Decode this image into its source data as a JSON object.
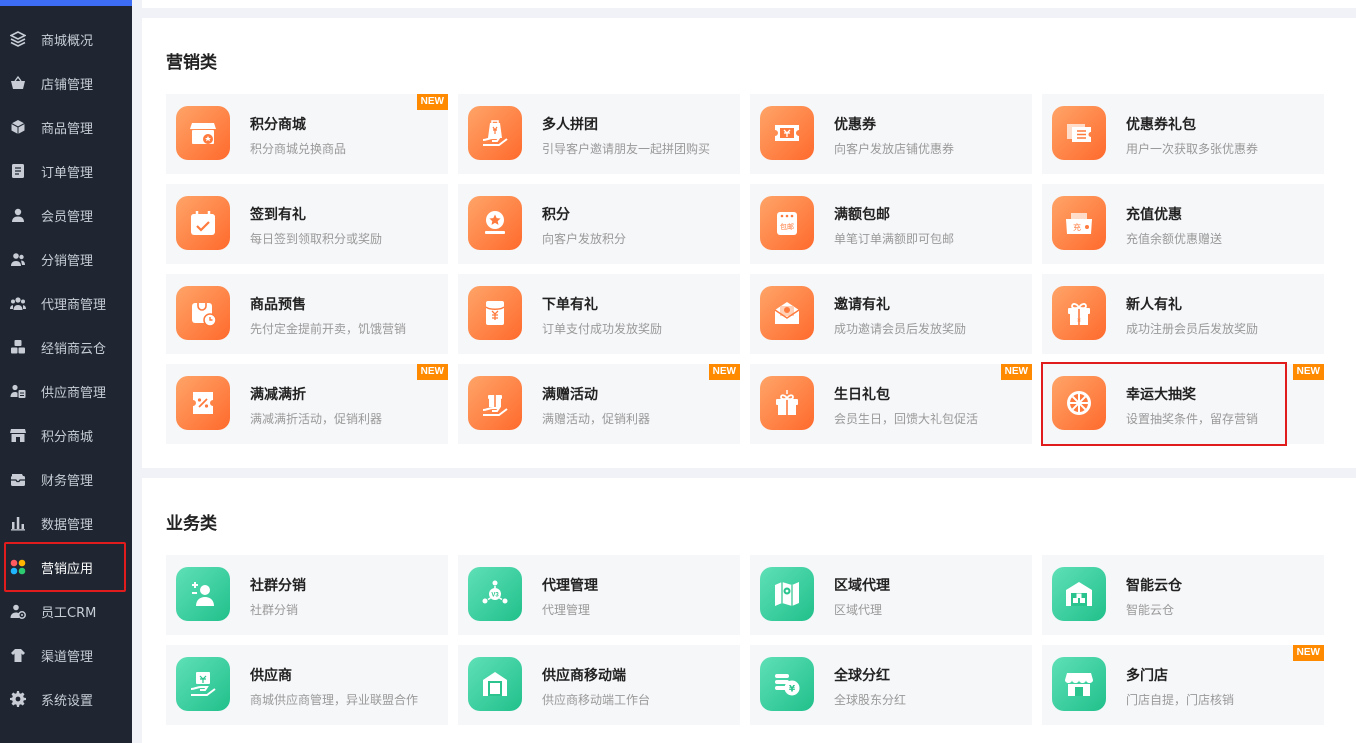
{
  "sidebar": {
    "items": [
      {
        "label": "商城概况",
        "icon": "layers-icon"
      },
      {
        "label": "店铺管理",
        "icon": "basket-icon"
      },
      {
        "label": "商品管理",
        "icon": "cube-icon"
      },
      {
        "label": "订单管理",
        "icon": "document-icon"
      },
      {
        "label": "会员管理",
        "icon": "user-icon"
      },
      {
        "label": "分销管理",
        "icon": "users-icon"
      },
      {
        "label": "代理商管理",
        "icon": "group-icon"
      },
      {
        "label": "经销商云仓",
        "icon": "boxes-icon"
      },
      {
        "label": "供应商管理",
        "icon": "supplier-icon"
      },
      {
        "label": "积分商城",
        "icon": "store-icon"
      },
      {
        "label": "财务管理",
        "icon": "wallet-icon"
      },
      {
        "label": "数据管理",
        "icon": "bar-chart-icon"
      },
      {
        "label": "营销应用",
        "icon": "apps-icon",
        "active": true
      },
      {
        "label": "员工CRM",
        "icon": "staff-icon"
      },
      {
        "label": "渠道管理",
        "icon": "channel-icon"
      },
      {
        "label": "系统设置",
        "icon": "gear-icon"
      }
    ]
  },
  "marketing": {
    "title": "营销类",
    "cards": [
      {
        "title": "积分商城",
        "desc": "积分商城兑换商品",
        "badge": "NEW",
        "icon": "points-store-icon"
      },
      {
        "title": "多人拼团",
        "desc": "引导客户邀请朋友一起拼团购买",
        "icon": "group-buy-icon"
      },
      {
        "title": "优惠券",
        "desc": "向客户发放店铺优惠券",
        "icon": "coupon-icon"
      },
      {
        "title": "优惠券礼包",
        "desc": "用户一次获取多张优惠券",
        "icon": "coupon-pack-icon"
      },
      {
        "title": "签到有礼",
        "desc": "每日签到领取积分或奖励",
        "icon": "calendar-check-icon"
      },
      {
        "title": "积分",
        "desc": "向客户发放积分",
        "icon": "star-icon"
      },
      {
        "title": "满额包邮",
        "desc": "单笔订单满额即可包邮",
        "icon": "free-shipping-icon"
      },
      {
        "title": "充值优惠",
        "desc": "充值余额优惠赠送",
        "icon": "recharge-icon"
      },
      {
        "title": "商品预售",
        "desc": "先付定金提前开卖，饥饿营销",
        "icon": "presale-icon"
      },
      {
        "title": "下单有礼",
        "desc": "订单支付成功发放奖励",
        "icon": "red-envelope-icon"
      },
      {
        "title": "邀请有礼",
        "desc": "成功邀请会员后发放奖励",
        "icon": "invite-envelope-icon"
      },
      {
        "title": "新人有礼",
        "desc": "成功注册会员后发放奖励",
        "icon": "newcomer-gift-icon"
      },
      {
        "title": "满减满折",
        "desc": "满减满折活动，促销利器",
        "badge": "NEW",
        "icon": "discount-ticket-icon"
      },
      {
        "title": "满赠活动",
        "desc": "满赠活动，促销利器",
        "badge": "NEW",
        "icon": "gift-hand-icon"
      },
      {
        "title": "生日礼包",
        "desc": "会员生日，回馈大礼包促活",
        "badge": "NEW",
        "icon": "birthday-gift-icon"
      },
      {
        "title": "幸运大抽奖",
        "desc": "设置抽奖条件，留存营销",
        "badge": "NEW",
        "icon": "lottery-wheel-icon"
      }
    ]
  },
  "business": {
    "title": "业务类",
    "cards": [
      {
        "title": "社群分销",
        "desc": "社群分销",
        "icon": "community-icon"
      },
      {
        "title": "代理管理",
        "desc": "代理管理",
        "icon": "agent-icon"
      },
      {
        "title": "区域代理",
        "desc": "区域代理",
        "icon": "region-map-icon"
      },
      {
        "title": "智能云仓",
        "desc": "智能云仓",
        "icon": "warehouse-icon"
      },
      {
        "title": "供应商",
        "desc": "商城供应商管理，异业联盟合作",
        "icon": "supplier-hand-icon"
      },
      {
        "title": "供应商移动端",
        "desc": "供应商移动端工作台",
        "icon": "supplier-mobile-icon"
      },
      {
        "title": "全球分红",
        "desc": "全球股东分红",
        "icon": "dividend-coins-icon"
      },
      {
        "title": "多门店",
        "desc": "门店自提，门店核销",
        "badge": "NEW",
        "icon": "multi-store-icon"
      }
    ]
  },
  "colors": {
    "sidebar_bg": "#1f2631",
    "accent_orange": "#ff6a2d",
    "accent_green": "#21c08b",
    "badge": "#ff8a00",
    "highlight": "#e01c1c"
  }
}
